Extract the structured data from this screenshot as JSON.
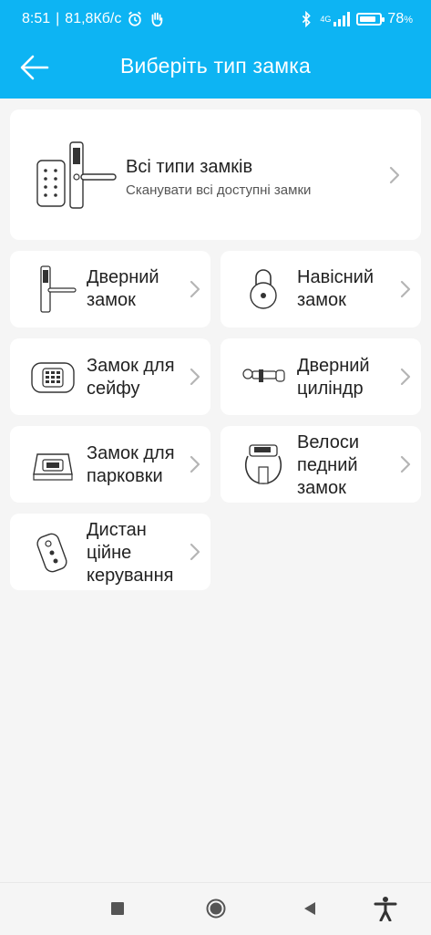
{
  "status": {
    "time": "8:51",
    "speed": "81,8Кб/с",
    "network": "4G",
    "battery": "78",
    "battery_unit": "%"
  },
  "header": {
    "title": "Виберіть тип замка"
  },
  "all_types": {
    "title": "Всі типи замків",
    "subtitle": "Сканувати всі доступні замки"
  },
  "items": [
    {
      "label_1": "Дверний",
      "label_2": "замок",
      "label_3": "",
      "icon": "door-lock-icon"
    },
    {
      "label_1": "Навісний",
      "label_2": "замок",
      "label_3": "",
      "icon": "padlock-icon"
    },
    {
      "label_1": "Замок для",
      "label_2": "сейфу",
      "label_3": "",
      "icon": "safe-lock-icon"
    },
    {
      "label_1": "Дверний",
      "label_2": "циліндр",
      "label_3": "",
      "icon": "door-cylinder-icon"
    },
    {
      "label_1": "Замок для",
      "label_2": "парковки",
      "label_3": "",
      "icon": "parking-lock-icon"
    },
    {
      "label_1": "Велоси",
      "label_2": "педний",
      "label_3": "замок",
      "icon": "bike-lock-icon"
    },
    {
      "label_1": "Дистан",
      "label_2": "ційне",
      "label_3": "керування",
      "icon": "remote-control-icon"
    }
  ],
  "colors": {
    "header_bg": "#0db4f3",
    "page_bg": "#f5f5f5",
    "card_bg": "#ffffff",
    "chevron": "#b5b5b5"
  }
}
